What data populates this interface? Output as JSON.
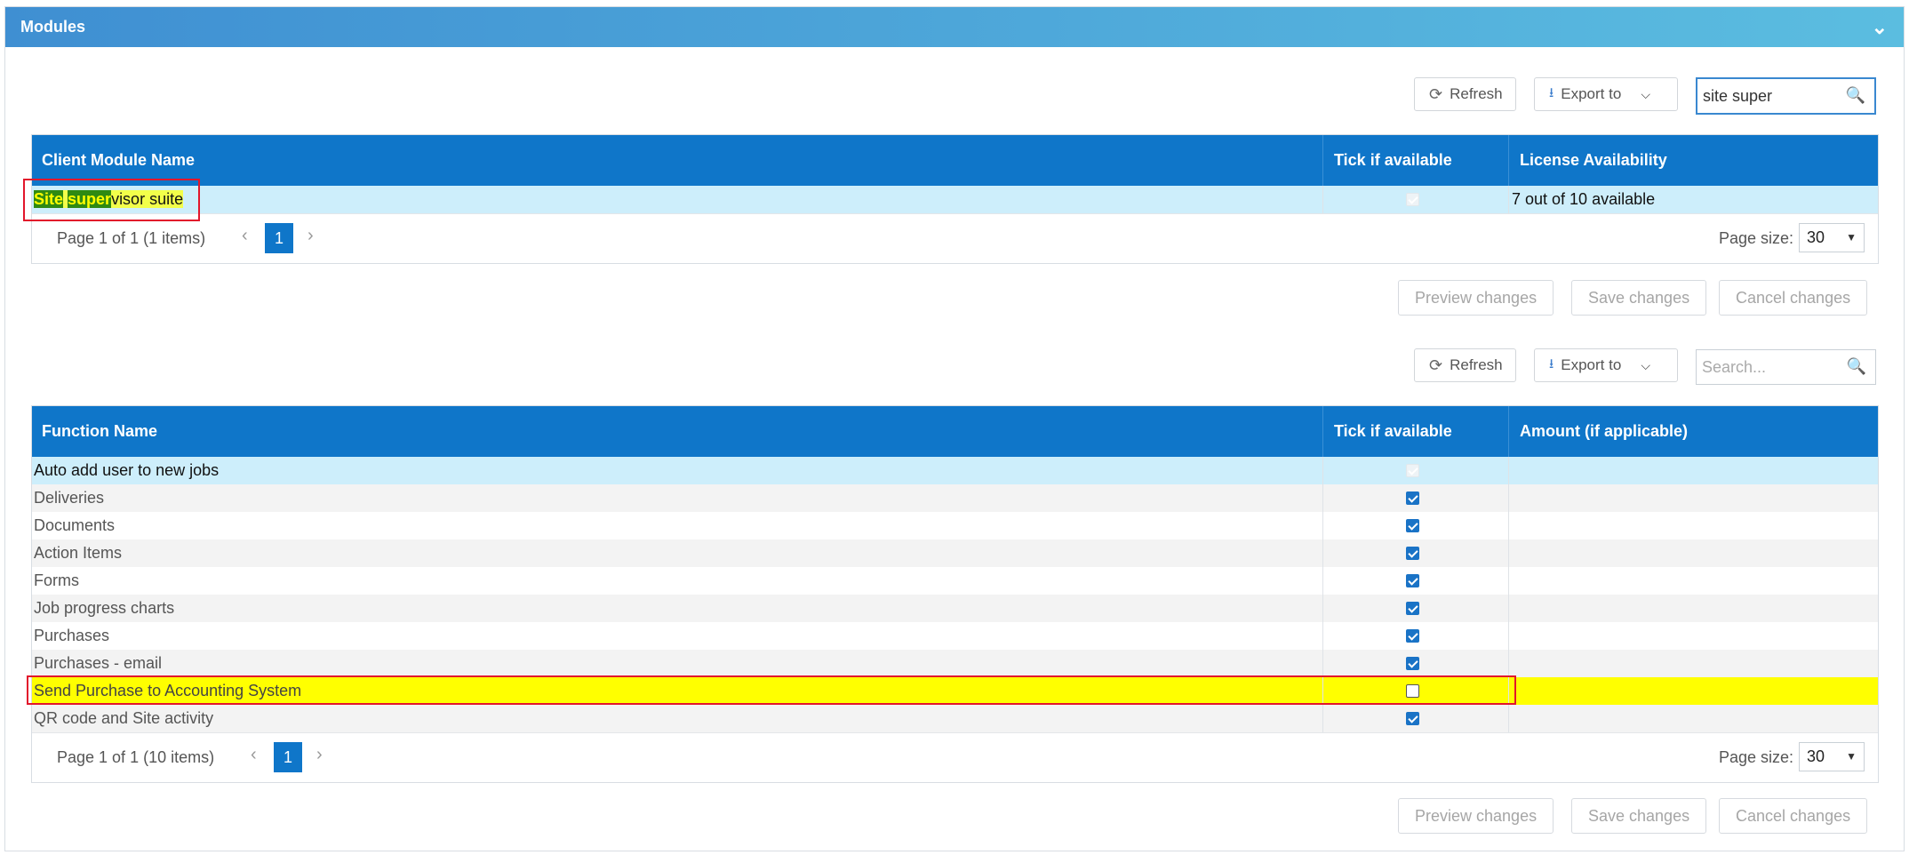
{
  "panel": {
    "title": "Modules"
  },
  "toolbar1": {
    "refresh": "Refresh",
    "export": "Export to",
    "search_value": "site super"
  },
  "grid1": {
    "headers": [
      "Client Module Name",
      "Tick if available",
      "License Availability"
    ],
    "row": {
      "name_match1": "Site",
      "name_space": " ",
      "name_match2": "super",
      "name_rest": "visor suite",
      "checked": true,
      "availability": "7 out of 10 available"
    },
    "pager": {
      "info": "Page 1 of 1 (1 items)",
      "page": "1",
      "page_size_label": "Page size:",
      "page_size": "30"
    }
  },
  "actions1": {
    "preview": "Preview changes",
    "save": "Save changes",
    "cancel": "Cancel changes"
  },
  "toolbar2": {
    "refresh": "Refresh",
    "export": "Export to",
    "search_placeholder": "Search..."
  },
  "grid2": {
    "headers": [
      "Function Name",
      "Tick if available",
      "Amount (if applicable)"
    ],
    "rows": [
      {
        "name": "Auto add user to new jobs",
        "checked": true
      },
      {
        "name": "Deliveries",
        "checked": true
      },
      {
        "name": "Documents",
        "checked": true
      },
      {
        "name": "Action Items",
        "checked": true
      },
      {
        "name": "Forms",
        "checked": true
      },
      {
        "name": "Job progress charts",
        "checked": true
      },
      {
        "name": "Purchases",
        "checked": true
      },
      {
        "name": "Purchases - email",
        "checked": true
      },
      {
        "name": "Send Purchase to Accounting System",
        "checked": false
      },
      {
        "name": "QR code and Site activity",
        "checked": true
      }
    ],
    "pager": {
      "info": "Page 1 of 1 (10 items)",
      "page": "1",
      "page_size_label": "Page size:",
      "page_size": "30"
    }
  },
  "actions2": {
    "preview": "Preview changes",
    "save": "Save changes",
    "cancel": "Cancel changes"
  },
  "icons": {
    "collapse": "chevron-down-icon",
    "refresh": "refresh-icon",
    "export": "download-icon",
    "search": "search-icon"
  },
  "colors": {
    "header_blue": "#0f76c9",
    "selected_row": "#cdeefb",
    "highlight": "#ffff00",
    "annotation_red": "#e2162b"
  }
}
